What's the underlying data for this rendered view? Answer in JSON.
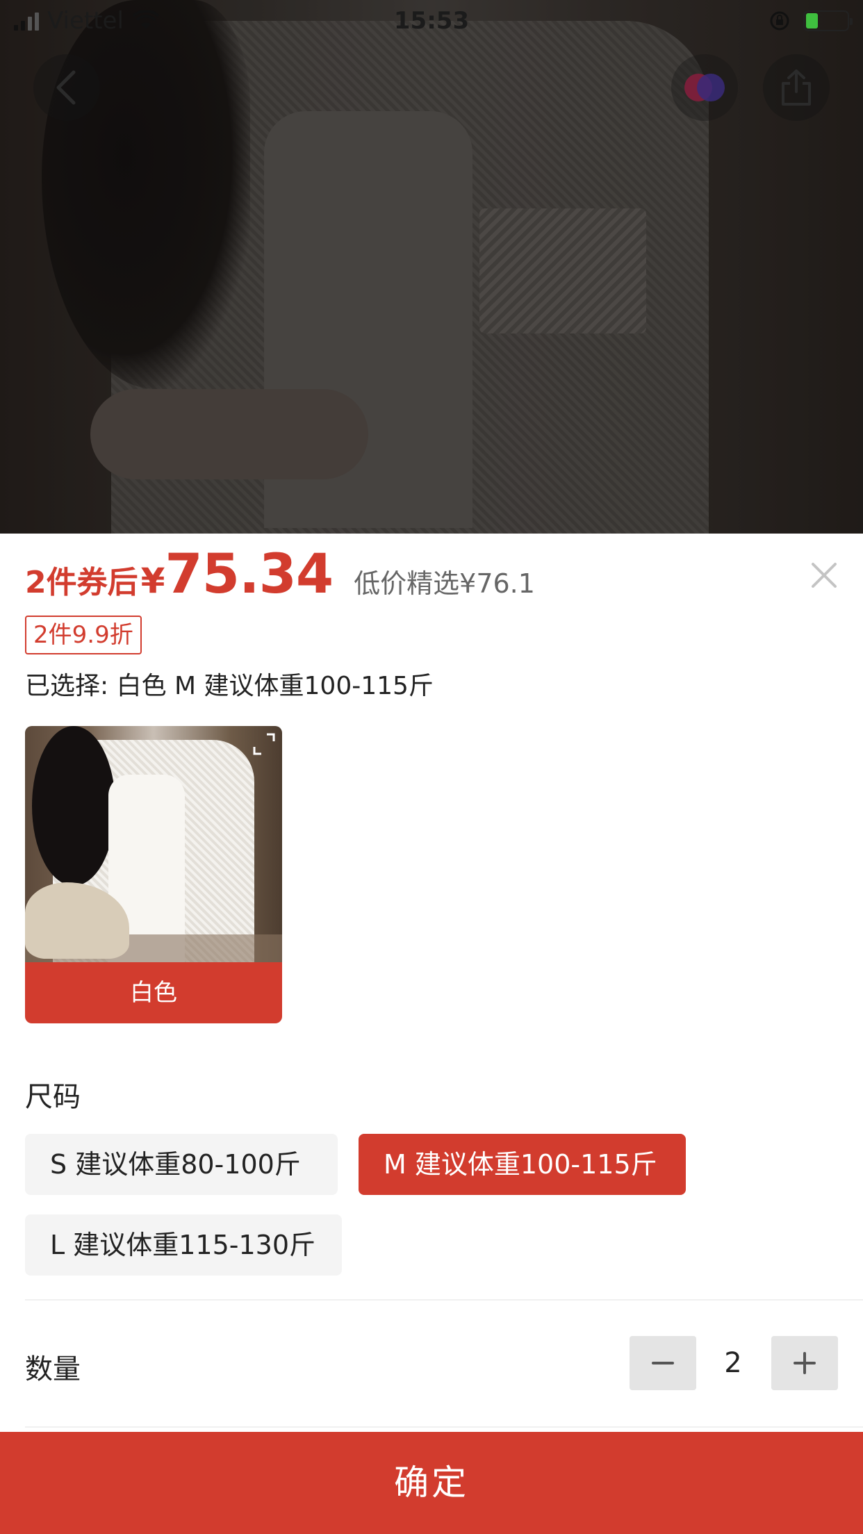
{
  "status_bar": {
    "carrier": "Viettel",
    "time": "15:53"
  },
  "header": {
    "back_icon": "chevron-left-icon",
    "brand_icon": "brand-logo-icon",
    "share_icon": "share-icon"
  },
  "product": {
    "price_prefix": "2件券后",
    "price_currency": "¥",
    "price_value": "75.34",
    "price_secondary": "低价精选¥76.1",
    "promo_tag": "2件9.9折",
    "selected_text": "已选择: 白色 M 建议体重100-115斤"
  },
  "colors": {
    "items": [
      {
        "label": "白色",
        "selected": true
      }
    ]
  },
  "size": {
    "title": "尺码",
    "options": [
      {
        "label": "S 建议体重80-100斤",
        "selected": false
      },
      {
        "label": "M 建议体重100-115斤",
        "selected": true
      },
      {
        "label": "L 建议体重115-130斤",
        "selected": false
      }
    ]
  },
  "quantity": {
    "title": "数量",
    "value": "2"
  },
  "confirm_label": "确定",
  "theme": {
    "accent": "#d23c2e"
  }
}
